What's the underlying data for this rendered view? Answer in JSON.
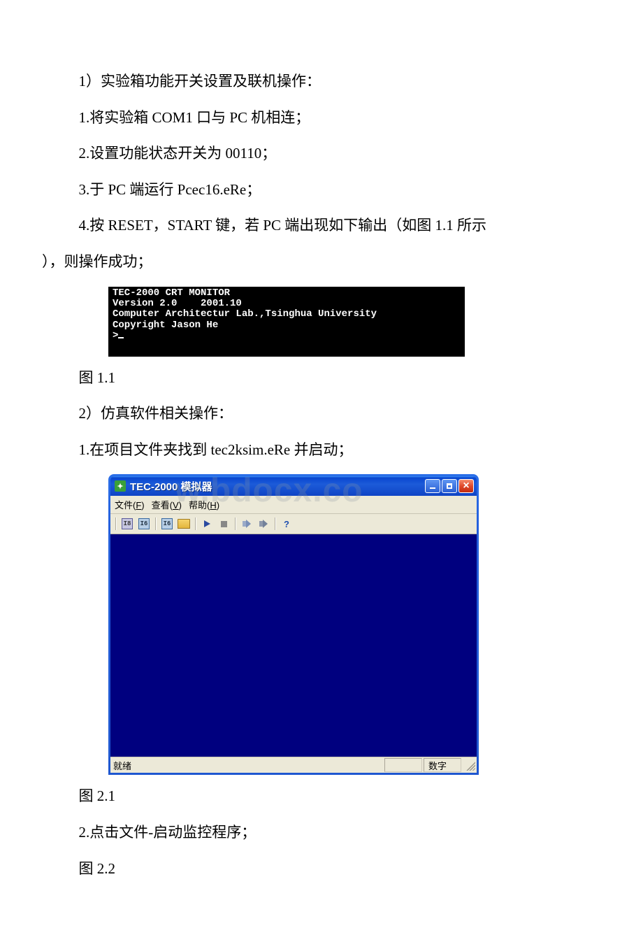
{
  "paragraphs": {
    "p1": "1）实验箱功能开关设置及联机操作：",
    "p2": "1.将实验箱 COM1 口与 PC 机相连；",
    "p3": "2.设置功能状态开关为 00110；",
    "p4": "3.于 PC 端运行 Pcec16.eRe；",
    "p5a": "4.按 RESET，START 键，若 PC 端出现如下输出（如图 1.1 所示",
    "p5b": "），则操作成功；",
    "caption1": "图 1.1",
    "p6": "2）仿真软件相关操作：",
    "p7": "1.在项目文件夹找到 tec2ksim.eRe 并启动；",
    "caption2": "图 2.1",
    "p8": "2.点击文件-启动监控程序；",
    "caption3": "图 2.2"
  },
  "terminal": {
    "l1": "TEC-2000 CRT MONITOR",
    "l2": "Version 2.0    2001.10",
    "l3": "Computer Architectur Lab.,Tsinghua University",
    "l4": "Copyright Jason He",
    "l5": ">"
  },
  "xp": {
    "title": "TEC-2000 模拟器",
    "menu": {
      "file": "文件(F)",
      "view": "查看(V)",
      "help": "帮助(H)"
    },
    "status": {
      "ready": "就绪",
      "numlock": "数字"
    },
    "watermark": "w.bdocx.co"
  },
  "icons": {
    "i8": "I8",
    "i16": "I6",
    "help": "?"
  }
}
